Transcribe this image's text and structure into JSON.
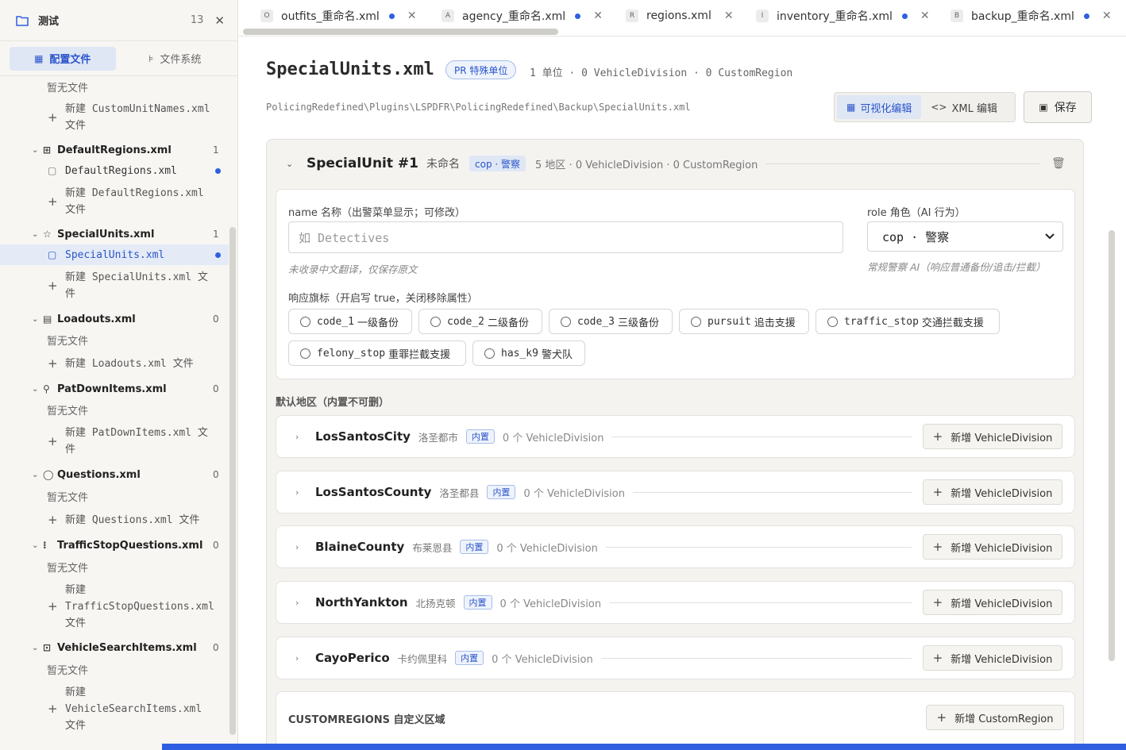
{
  "workspace": {
    "name": "测试",
    "count": "13"
  },
  "sidebar_tabs": [
    {
      "label": "配置文件",
      "icon": "grid-icon",
      "active": true
    },
    {
      "label": "文件系统",
      "icon": "tree-icon",
      "active": false
    }
  ],
  "tree": {
    "top_empty": "暂无文件",
    "top_new": [
      "新建 CustomUnitNames.xml",
      "文件"
    ],
    "groups": [
      {
        "name": "DefaultRegions.xml",
        "icon": "map-icon",
        "count": "1",
        "file": "DefaultRegions.xml",
        "new": [
          "新建 DefaultRegions.xml",
          "文件"
        ]
      },
      {
        "name": "SpecialUnits.xml",
        "icon": "star-icon",
        "count": "1",
        "file": "SpecialUnits.xml",
        "new": [
          "新建 SpecialUnits.xml 文",
          "件"
        ]
      },
      {
        "name": "Loadouts.xml",
        "icon": "clipboard-icon",
        "count": "0",
        "empty": "暂无文件",
        "new": [
          "新建 Loadouts.xml 文件"
        ]
      },
      {
        "name": "PatDownItems.xml",
        "icon": "user-search-icon",
        "count": "0",
        "empty": "暂无文件",
        "new": [
          "新建 PatDownItems.xml 文",
          "件"
        ]
      },
      {
        "name": "Questions.xml",
        "icon": "chat-icon",
        "count": "0",
        "empty": "暂无文件",
        "new": [
          "新建 Questions.xml 文件"
        ]
      },
      {
        "name": "TrafficStopQuestions.xml",
        "icon": "traffic-light-icon",
        "count": "0",
        "empty": "暂无文件",
        "new": [
          "新建",
          "TrafficStopQuestions.xml",
          "文件"
        ]
      },
      {
        "name": "VehicleSearchItems.xml",
        "icon": "car-icon",
        "count": "0",
        "empty": "暂无文件",
        "new": [
          "新建",
          "VehicleSearchItems.xml",
          "文件"
        ]
      }
    ]
  },
  "tabs": [
    {
      "badge": "O",
      "label": "outfits_重命名.xml",
      "modified": true
    },
    {
      "badge": "A",
      "label": "agency_重命名.xml",
      "modified": true
    },
    {
      "badge": "R",
      "label": "regions.xml",
      "modified": false
    },
    {
      "badge": "I",
      "label": "inventory_重命名.xml",
      "modified": true
    },
    {
      "badge": "B",
      "label": "backup_重命名.xml",
      "modified": true
    }
  ],
  "page": {
    "title": "SpecialUnits.xml",
    "badge": "PR 特殊单位",
    "stats": "1 单位 · 0 VehicleDivision · 0 CustomRegion",
    "path": "PolicingRedefined\\Plugins\\LSPDFR\\PolicingRedefined\\Backup\\SpecialUnits.xml",
    "mode_visual": "可视化编辑",
    "mode_xml": "XML 编辑",
    "save": "保存"
  },
  "unit": {
    "title": "SpecialUnit #1",
    "subtitle": "未命名",
    "role_badge": "cop · 警察",
    "stats": "5 地区 · 0 VehicleDivision · 0 CustomRegion",
    "name_label": "name 名称（出警菜单显示；可修改）",
    "name_placeholder": "如 Detectives",
    "name_hint": "未收录中文翻译，仅保存原文",
    "role_label": "role 角色（AI 行为）",
    "role_value": "cop · 警察",
    "role_hint": "常规警察 AI（响应普通备份/追击/拦截）",
    "flags_label": "响应旗标（开启写 true，关闭移除属性）",
    "flags": [
      {
        "key": "code_1",
        "label": "一级备份"
      },
      {
        "key": "code_2",
        "label": "二级备份"
      },
      {
        "key": "code_3",
        "label": "三级备份"
      },
      {
        "key": "pursuit",
        "label": "追击支援"
      },
      {
        "key": "traffic_stop",
        "label": "交通拦截支援"
      },
      {
        "key": "felony_stop",
        "label": "重罪拦截支援"
      },
      {
        "key": "has_k9",
        "label": "警犬队"
      }
    ]
  },
  "regions": {
    "title": "默认地区（内置不可删）",
    "builtin_label": "内置",
    "add_label": "新增 VehicleDivision",
    "items": [
      {
        "name": "LosSantosCity",
        "cn": "洛圣都市",
        "count": "0 个 VehicleDivision"
      },
      {
        "name": "LosSantosCounty",
        "cn": "洛圣都县",
        "count": "0 个 VehicleDivision"
      },
      {
        "name": "BlaineCounty",
        "cn": "布莱恩县",
        "count": "0 个 VehicleDivision"
      },
      {
        "name": "NorthYankton",
        "cn": "北扬克顿",
        "count": "0 个 VehicleDivision"
      },
      {
        "name": "CayoPerico",
        "cn": "卡约佩里科",
        "count": "0 个 VehicleDivision"
      }
    ]
  },
  "custom_regions": {
    "title": "CUSTOMREGIONS 自定义区域",
    "add_label": "新增 CustomRegion"
  },
  "colors": {
    "accent": "#2f5fe0",
    "accent_text": "#2b55c9",
    "sidebar_bg": "#f7f6f3"
  }
}
